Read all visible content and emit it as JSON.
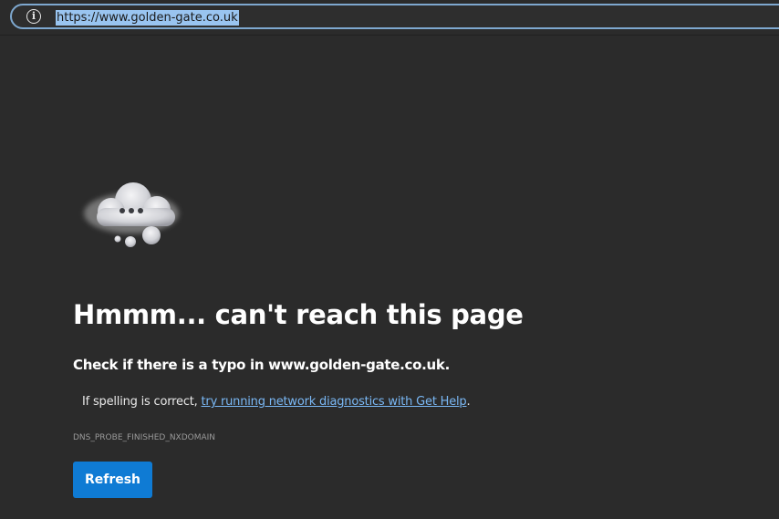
{
  "address_bar": {
    "url": "https://www.golden-gate.co.uk",
    "info_icon": "info-icon"
  },
  "error_page": {
    "illustration": "cloud-thinking-icon",
    "headline": "Hmmm... can't reach this page",
    "check_text": "Check if there is a typo in www.golden-gate.co.uk.",
    "spelling_prefix": "If spelling is correct, ",
    "diagnostics_link": "try running network diagnostics with Get Help",
    "spelling_suffix": ".",
    "error_code": "DNS_PROBE_FINISHED_NXDOMAIN",
    "refresh_label": "Refresh"
  },
  "colors": {
    "background": "#2b2b2b",
    "address_border": "#7ea8cf",
    "url_selection": "#99c4f0",
    "link": "#7ab8f5",
    "button": "#0f7bd4"
  }
}
